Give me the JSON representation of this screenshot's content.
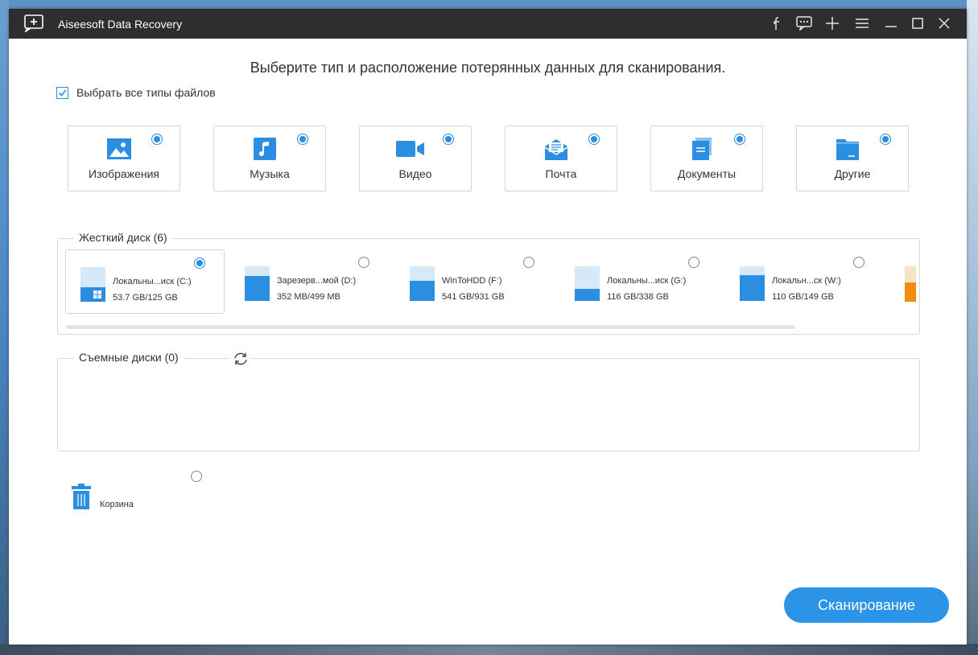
{
  "app": {
    "title": "Aiseesoft Data Recovery"
  },
  "titlebar_buttons": [
    "facebook-icon",
    "feedback-icon",
    "plus-icon",
    "menu-icon",
    "minimize-icon",
    "maximize-icon",
    "close-icon"
  ],
  "heading": "Выберите тип и расположение потерянных данных для сканирования.",
  "select_all": {
    "label": "Выбрать все типы файлов",
    "checked": true
  },
  "file_types": [
    {
      "label": "Изображения",
      "icon": "image-icon",
      "selected": true
    },
    {
      "label": "Музыка",
      "icon": "music-icon",
      "selected": true
    },
    {
      "label": "Видео",
      "icon": "video-icon",
      "selected": true
    },
    {
      "label": "Почта",
      "icon": "mail-icon",
      "selected": true
    },
    {
      "label": "Документы",
      "icon": "document-icon",
      "selected": true
    },
    {
      "label": "Другие",
      "icon": "folder-icon",
      "selected": true
    }
  ],
  "hard_disks": {
    "title": "Жесткий диск (6)",
    "drives": [
      {
        "name": "Локальны...иск (C:)",
        "size": "53.7 GB/125 GB",
        "used_fraction": 0.43,
        "selected": true,
        "system": true
      },
      {
        "name": "Зарезерв...мой (D:)",
        "size": "352 MB/499 MB",
        "used_fraction": 0.71,
        "selected": false
      },
      {
        "name": "WinToHDD (F:)",
        "size": "541 GB/931 GB",
        "used_fraction": 0.58,
        "selected": false
      },
      {
        "name": "Локальны...иск (G:)",
        "size": "116 GB/338 GB",
        "used_fraction": 0.34,
        "selected": false
      },
      {
        "name": "Локальн...ск (W:)",
        "size": "110 GB/149 GB",
        "used_fraction": 0.74,
        "selected": false
      }
    ]
  },
  "removable": {
    "title": "Съемные диски (0)"
  },
  "recycle_bin": {
    "label": "Корзина",
    "selected": false
  },
  "scan_button": {
    "label": "Сканирование"
  },
  "colors": {
    "accent": "#2b8ee0",
    "scan_button": "#2b94e6",
    "titlebar": "#2e2e2e"
  }
}
